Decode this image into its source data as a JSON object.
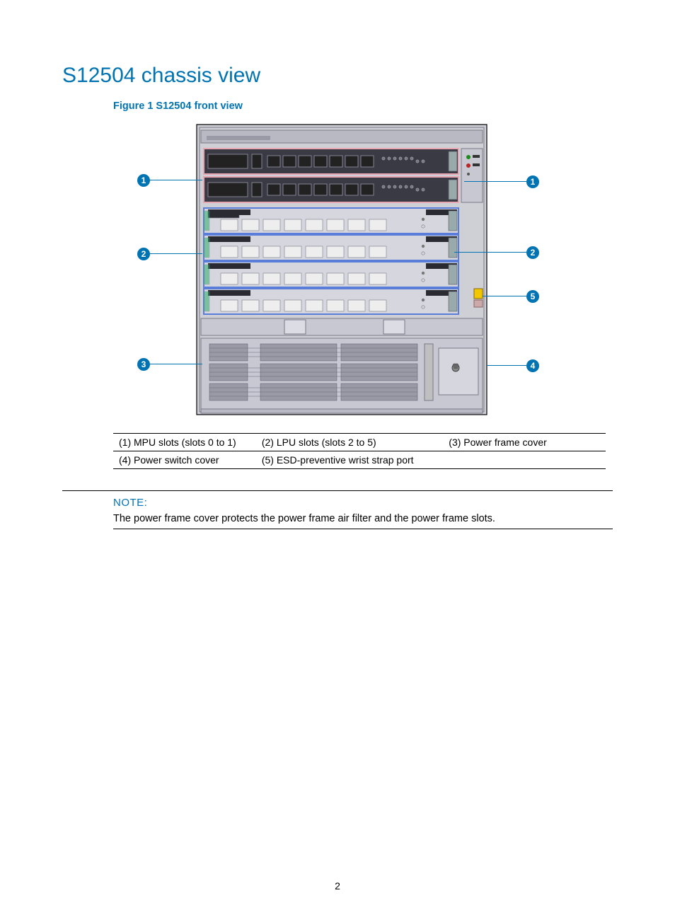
{
  "title": "S12504 chassis view",
  "figure_caption": "Figure 1 S12504 front view",
  "callouts": {
    "c1": "1",
    "c2": "2",
    "c3": "3",
    "c4": "4",
    "c5": "5"
  },
  "legend": {
    "r1c1": "(1) MPU slots (slots 0 to 1)",
    "r1c2": "(2) LPU slots (slots 2 to 5)",
    "r1c3": "(3) Power frame cover",
    "r2c1": "(4) Power switch cover",
    "r2c2": "(5) ESD-preventive wrist strap port",
    "r2c3": ""
  },
  "note_label": "NOTE:",
  "note_text": "The power frame cover protects the power frame air filter and the power frame slots.",
  "page_number": "2",
  "chart_data": {
    "type": "diagram",
    "components": [
      {
        "id": 1,
        "label": "MPU slots (slots 0 to 1)",
        "count": 2,
        "position": "top (2 pink-outlined modules)"
      },
      {
        "id": 2,
        "label": "LPU slots (slots 2 to 5)",
        "count": 4,
        "position": "middle (4 blue-outlined modules)"
      },
      {
        "id": 3,
        "label": "Power frame cover",
        "count": 1,
        "position": "bottom-left ventilation grids"
      },
      {
        "id": 4,
        "label": "Power switch cover",
        "count": 1,
        "position": "bottom-right small panel"
      },
      {
        "id": 5,
        "label": "ESD-preventive wrist strap port",
        "count": 1,
        "position": "right side, near slot 5, yellow marker"
      }
    ],
    "title": "S12504 front view",
    "notes": "Chassis illustration with numbered callouts 1–5 on both sides pointing to module regions."
  }
}
